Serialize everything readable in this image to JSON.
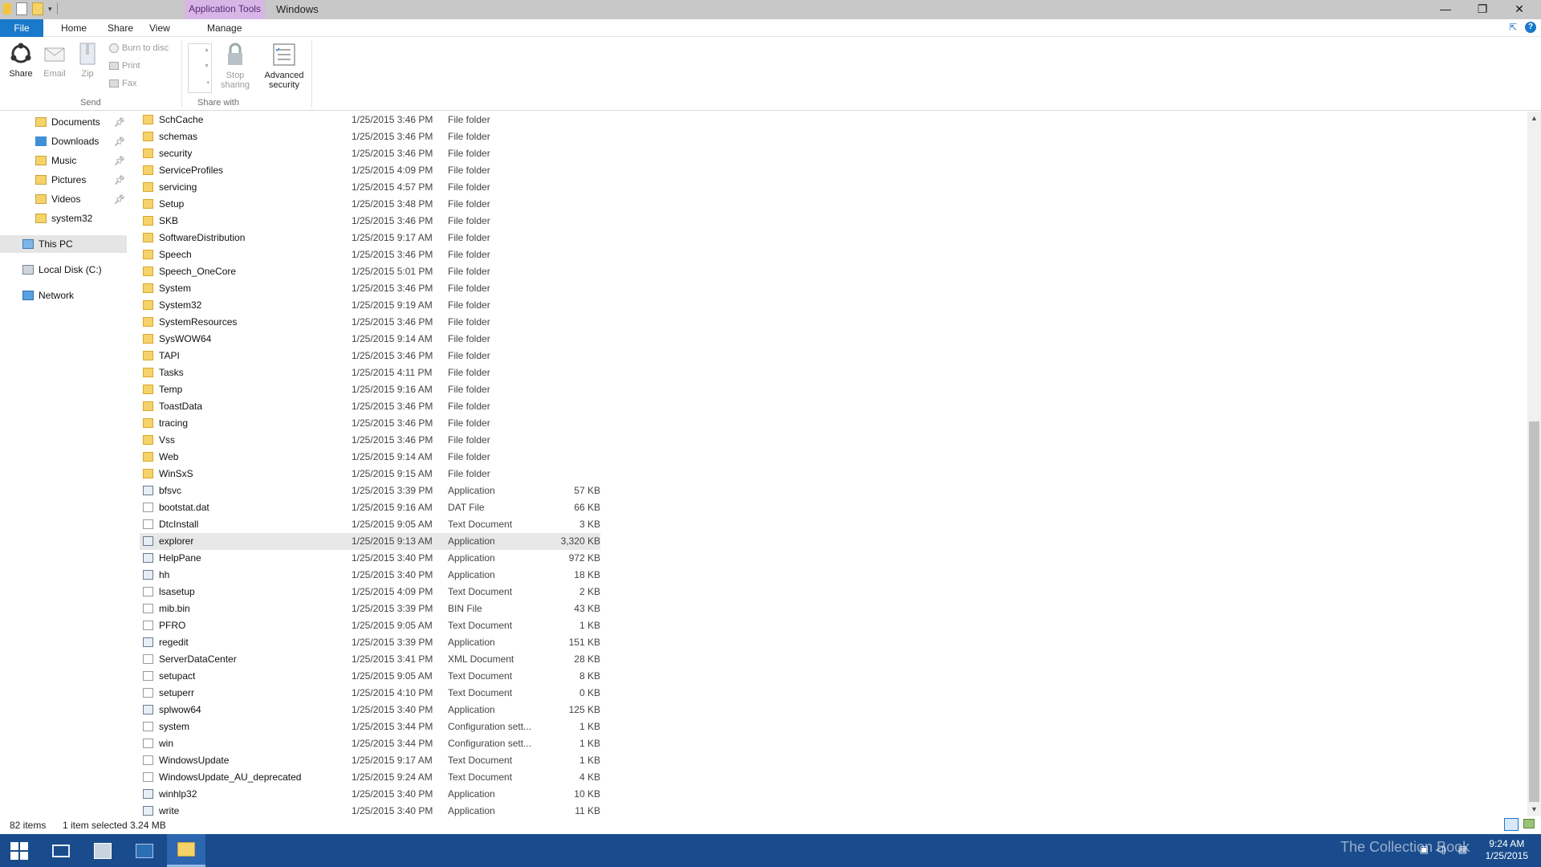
{
  "titlebar": {
    "context_tab": "Application Tools",
    "title": "Windows",
    "minimize": "—",
    "restore": "❐",
    "close": "✕"
  },
  "tabs": {
    "file": "File",
    "home": "Home",
    "share": "Share",
    "view": "View",
    "manage": "Manage"
  },
  "ribbon": {
    "share": "Share",
    "email": "Email",
    "zip": "Zip",
    "burn": "Burn to disc",
    "print": "Print",
    "fax": "Fax",
    "send_group": "Send",
    "stop_sharing_1": "Stop",
    "stop_sharing_2": "sharing",
    "advanced_1": "Advanced",
    "advanced_2": "security",
    "share_with_group": "Share with"
  },
  "nav": {
    "items": [
      {
        "label": "Documents"
      },
      {
        "label": "Downloads"
      },
      {
        "label": "Music"
      },
      {
        "label": "Pictures"
      },
      {
        "label": "Videos"
      },
      {
        "label": "system32"
      },
      {
        "label": "This PC"
      },
      {
        "label": "Local Disk (C:)"
      },
      {
        "label": "Network"
      }
    ]
  },
  "files": [
    {
      "name": "SchCache",
      "date": "1/25/2015 3:46 PM",
      "type": "File folder",
      "size": "",
      "kind": "folder"
    },
    {
      "name": "schemas",
      "date": "1/25/2015 3:46 PM",
      "type": "File folder",
      "size": "",
      "kind": "folder"
    },
    {
      "name": "security",
      "date": "1/25/2015 3:46 PM",
      "type": "File folder",
      "size": "",
      "kind": "folder"
    },
    {
      "name": "ServiceProfiles",
      "date": "1/25/2015 4:09 PM",
      "type": "File folder",
      "size": "",
      "kind": "folder"
    },
    {
      "name": "servicing",
      "date": "1/25/2015 4:57 PM",
      "type": "File folder",
      "size": "",
      "kind": "folder"
    },
    {
      "name": "Setup",
      "date": "1/25/2015 3:48 PM",
      "type": "File folder",
      "size": "",
      "kind": "folder"
    },
    {
      "name": "SKB",
      "date": "1/25/2015 3:46 PM",
      "type": "File folder",
      "size": "",
      "kind": "folder"
    },
    {
      "name": "SoftwareDistribution",
      "date": "1/25/2015 9:17 AM",
      "type": "File folder",
      "size": "",
      "kind": "folder"
    },
    {
      "name": "Speech",
      "date": "1/25/2015 3:46 PM",
      "type": "File folder",
      "size": "",
      "kind": "folder"
    },
    {
      "name": "Speech_OneCore",
      "date": "1/25/2015 5:01 PM",
      "type": "File folder",
      "size": "",
      "kind": "folder"
    },
    {
      "name": "System",
      "date": "1/25/2015 3:46 PM",
      "type": "File folder",
      "size": "",
      "kind": "folder"
    },
    {
      "name": "System32",
      "date": "1/25/2015 9:19 AM",
      "type": "File folder",
      "size": "",
      "kind": "folder"
    },
    {
      "name": "SystemResources",
      "date": "1/25/2015 3:46 PM",
      "type": "File folder",
      "size": "",
      "kind": "folder"
    },
    {
      "name": "SysWOW64",
      "date": "1/25/2015 9:14 AM",
      "type": "File folder",
      "size": "",
      "kind": "folder"
    },
    {
      "name": "TAPI",
      "date": "1/25/2015 3:46 PM",
      "type": "File folder",
      "size": "",
      "kind": "folder"
    },
    {
      "name": "Tasks",
      "date": "1/25/2015 4:11 PM",
      "type": "File folder",
      "size": "",
      "kind": "folder"
    },
    {
      "name": "Temp",
      "date": "1/25/2015 9:16 AM",
      "type": "File folder",
      "size": "",
      "kind": "folder"
    },
    {
      "name": "ToastData",
      "date": "1/25/2015 3:46 PM",
      "type": "File folder",
      "size": "",
      "kind": "folder"
    },
    {
      "name": "tracing",
      "date": "1/25/2015 3:46 PM",
      "type": "File folder",
      "size": "",
      "kind": "folder"
    },
    {
      "name": "Vss",
      "date": "1/25/2015 3:46 PM",
      "type": "File folder",
      "size": "",
      "kind": "folder"
    },
    {
      "name": "Web",
      "date": "1/25/2015 9:14 AM",
      "type": "File folder",
      "size": "",
      "kind": "folder"
    },
    {
      "name": "WinSxS",
      "date": "1/25/2015 9:15 AM",
      "type": "File folder",
      "size": "",
      "kind": "folder"
    },
    {
      "name": "bfsvc",
      "date": "1/25/2015 3:39 PM",
      "type": "Application",
      "size": "57 KB",
      "kind": "app"
    },
    {
      "name": "bootstat.dat",
      "date": "1/25/2015 9:16 AM",
      "type": "DAT File",
      "size": "66 KB",
      "kind": "doc"
    },
    {
      "name": "DtcInstall",
      "date": "1/25/2015 9:05 AM",
      "type": "Text Document",
      "size": "3 KB",
      "kind": "doc"
    },
    {
      "name": "explorer",
      "date": "1/25/2015 9:13 AM",
      "type": "Application",
      "size": "3,320 KB",
      "kind": "app",
      "selected": true
    },
    {
      "name": "HelpPane",
      "date": "1/25/2015 3:40 PM",
      "type": "Application",
      "size": "972 KB",
      "kind": "app"
    },
    {
      "name": "hh",
      "date": "1/25/2015 3:40 PM",
      "type": "Application",
      "size": "18 KB",
      "kind": "app"
    },
    {
      "name": "lsasetup",
      "date": "1/25/2015 4:09 PM",
      "type": "Text Document",
      "size": "2 KB",
      "kind": "doc"
    },
    {
      "name": "mib.bin",
      "date": "1/25/2015 3:39 PM",
      "type": "BIN File",
      "size": "43 KB",
      "kind": "doc"
    },
    {
      "name": "PFRO",
      "date": "1/25/2015 9:05 AM",
      "type": "Text Document",
      "size": "1 KB",
      "kind": "doc"
    },
    {
      "name": "regedit",
      "date": "1/25/2015 3:39 PM",
      "type": "Application",
      "size": "151 KB",
      "kind": "app"
    },
    {
      "name": "ServerDataCenter",
      "date": "1/25/2015 3:41 PM",
      "type": "XML Document",
      "size": "28 KB",
      "kind": "doc"
    },
    {
      "name": "setupact",
      "date": "1/25/2015 9:05 AM",
      "type": "Text Document",
      "size": "8 KB",
      "kind": "doc"
    },
    {
      "name": "setuperr",
      "date": "1/25/2015 4:10 PM",
      "type": "Text Document",
      "size": "0 KB",
      "kind": "doc"
    },
    {
      "name": "splwow64",
      "date": "1/25/2015 3:40 PM",
      "type": "Application",
      "size": "125 KB",
      "kind": "app"
    },
    {
      "name": "system",
      "date": "1/25/2015 3:44 PM",
      "type": "Configuration sett...",
      "size": "1 KB",
      "kind": "doc"
    },
    {
      "name": "win",
      "date": "1/25/2015 3:44 PM",
      "type": "Configuration sett...",
      "size": "1 KB",
      "kind": "doc"
    },
    {
      "name": "WindowsUpdate",
      "date": "1/25/2015 9:17 AM",
      "type": "Text Document",
      "size": "1 KB",
      "kind": "doc"
    },
    {
      "name": "WindowsUpdate_AU_deprecated",
      "date": "1/25/2015 9:24 AM",
      "type": "Text Document",
      "size": "4 KB",
      "kind": "doc"
    },
    {
      "name": "winhlp32",
      "date": "1/25/2015 3:40 PM",
      "type": "Application",
      "size": "10 KB",
      "kind": "app"
    },
    {
      "name": "write",
      "date": "1/25/2015 3:40 PM",
      "type": "Application",
      "size": "11 KB",
      "kind": "app"
    }
  ],
  "status": {
    "count": "82 items",
    "selected": "1 item selected  3.24 MB"
  },
  "taskbar": {
    "time": "9:24 AM",
    "date": "1/25/2015",
    "watermark": "The Collection Book"
  },
  "colors": {
    "accent": "#1979ca",
    "context_tab": "#d7b6e6",
    "taskbar": "#1a4b8c",
    "folder": "#f6d26a"
  }
}
